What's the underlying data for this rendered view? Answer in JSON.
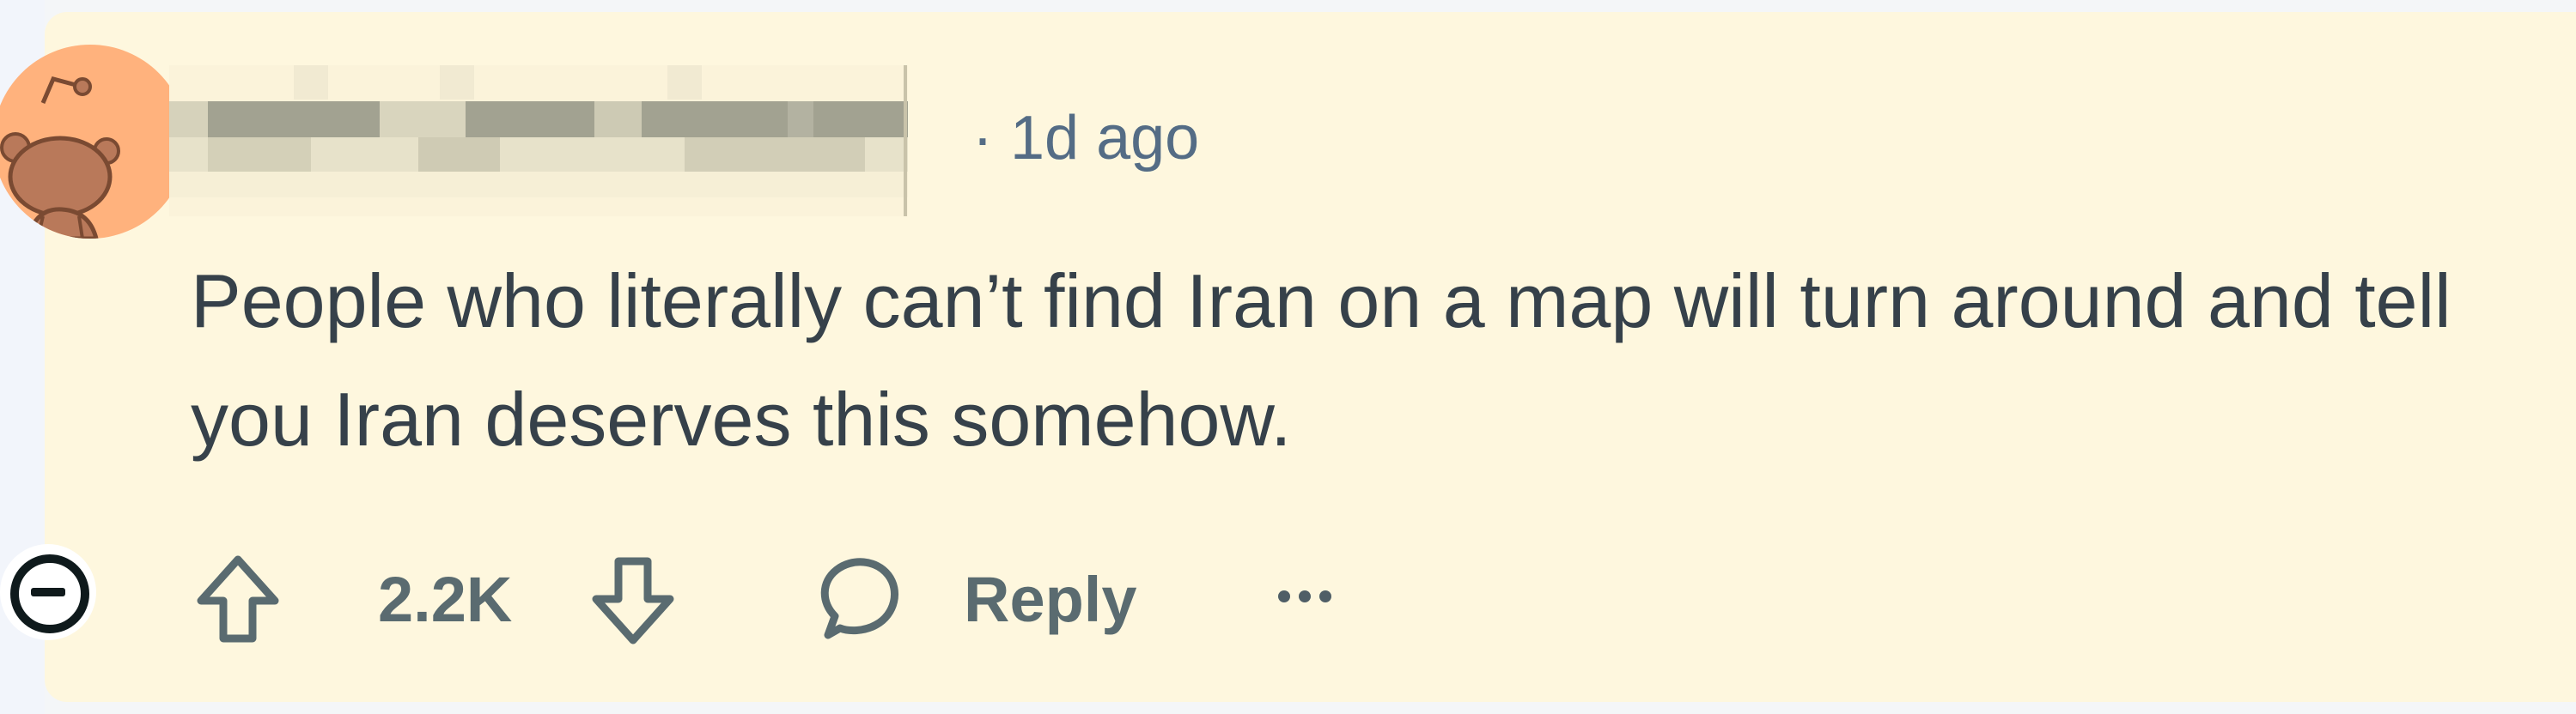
{
  "comment": {
    "username_redacted": true,
    "timestamp": "· 1d ago",
    "body": "People who literally can’t find Iran on a map will turn around and tell you Iran deserves this somehow.",
    "vote_count": "2.2K",
    "reply_label": "Reply"
  },
  "icons": {
    "avatar": "snoo-avatar",
    "collapse": "collapse-minus-circle-icon",
    "upvote": "upvote-arrow-icon",
    "downvote": "downvote-arrow-icon",
    "reply": "speech-bubble-icon",
    "more": "overflow-dots-icon"
  },
  "colors": {
    "card_background": "#fef7de",
    "avatar_background": "#ffb27d",
    "body_text": "#36414a",
    "meta_text": "#546c85",
    "action_text": "#5a6b70"
  }
}
